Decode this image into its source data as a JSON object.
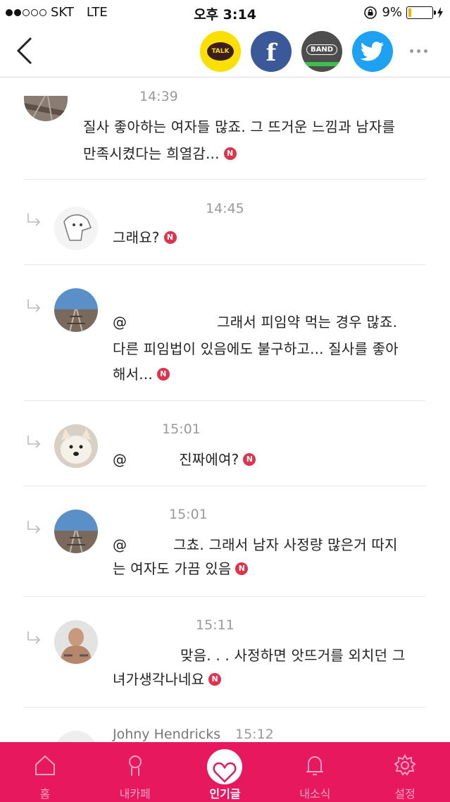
{
  "status_bar": {
    "carrier": "SKT",
    "network": "LTE",
    "time": "오후 3:14",
    "battery_percent": "9%",
    "signal_bars": 2
  },
  "share_bar": {
    "kakao_label": "TALK",
    "facebook_label": "f",
    "band_label": "BAND"
  },
  "comments": [
    {
      "author": "",
      "time": "14:39",
      "lines": [
        "질사 좋아하는 여자들 많죠. 그 뜨거운 느낌과 남자를",
        "만족시켰다는 희열감..."
      ],
      "reply": false,
      "avatar": "railroad"
    },
    {
      "author": "",
      "time": "14:45",
      "lines": [
        "그래요?"
      ],
      "reply": true,
      "avatar": "cartoon"
    },
    {
      "author": "",
      "time": "",
      "mention": "@",
      "lines": [
        "그래서 피임약 먹는 경우 많죠.",
        "다른 피임법이 있음에도 불구하고... 질사를 좋아",
        "해서..."
      ],
      "reply": true,
      "avatar": "railroad"
    },
    {
      "author": "",
      "time": "15:01",
      "mention": "@",
      "lines": [
        "진짜에여?"
      ],
      "reply": true,
      "avatar": "dog"
    },
    {
      "author": "",
      "time": "15:01",
      "mention": "@",
      "lines": [
        "그쵸. 그래서 남자 사정량 많은거 따지",
        "는 여자도 가끔 있음"
      ],
      "reply": true,
      "avatar": "railroad"
    },
    {
      "author": "",
      "time": "15:11",
      "mention": "",
      "lines": [
        "맞음. . . 사정하면 앗뜨거를 외치던 그",
        "녀가생각나네요"
      ],
      "reply": true,
      "avatar": "fighter"
    },
    {
      "author": "Johny Hendricks",
      "time": "15:12",
      "lines": [],
      "reply": true,
      "avatar": "cartoon"
    }
  ],
  "badge_text": "N",
  "tabs": [
    {
      "label": "홈",
      "icon": "home-icon"
    },
    {
      "label": "내카페",
      "icon": "person-icon"
    },
    {
      "label": "인기글",
      "icon": "heart-icon"
    },
    {
      "label": "내소식",
      "icon": "bell-icon"
    },
    {
      "label": "설정",
      "icon": "gear-icon"
    }
  ],
  "colors": {
    "tab_bar": "#e8185f",
    "badge": "#e4314b",
    "kakao": "#f9e000",
    "facebook": "#3b5998",
    "twitter": "#1da1f2"
  }
}
